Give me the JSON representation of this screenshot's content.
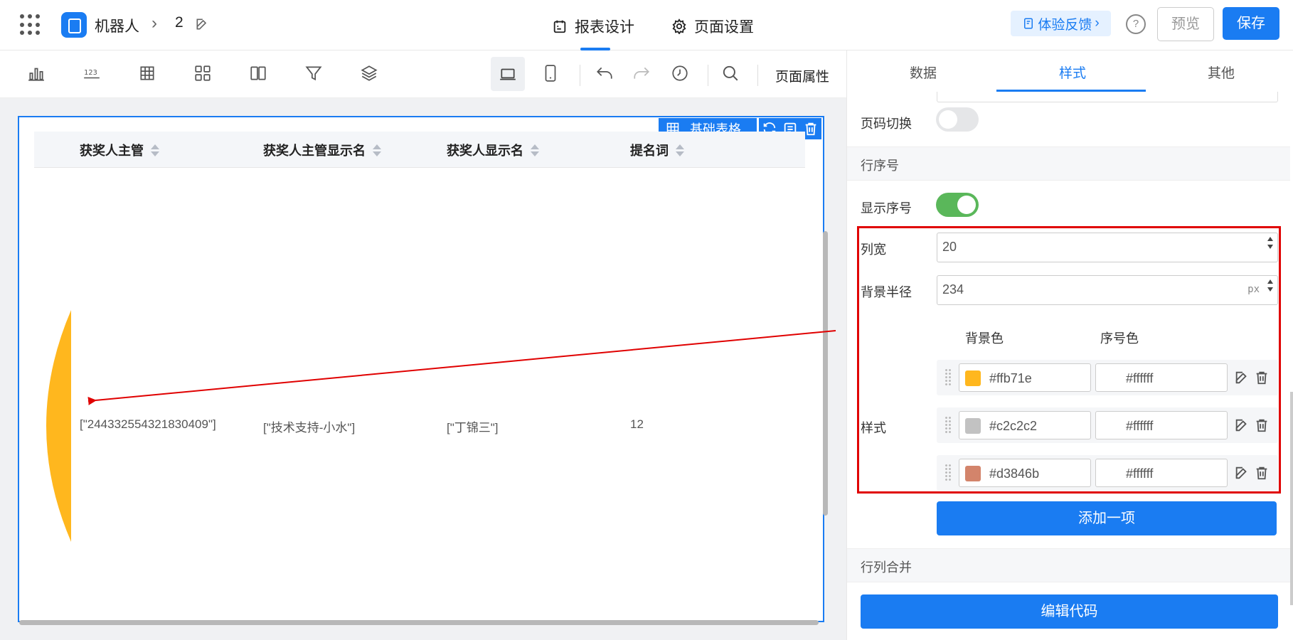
{
  "header": {
    "app_name": "机器人",
    "page_number": "2",
    "tabs": [
      {
        "label": "报表设计",
        "active": true
      },
      {
        "label": "页面设置",
        "active": false
      }
    ],
    "feedback_label": "体验反馈",
    "help_label": "?",
    "preview_label": "预览",
    "save_label": "保存"
  },
  "toolbar": {
    "icons": [
      "chart-icon",
      "number-icon",
      "table-icon",
      "layout-icon",
      "columns-icon",
      "filter-icon",
      "layers-icon",
      "desktop-icon",
      "mobile-icon",
      "undo-icon",
      "redo-icon",
      "history-icon",
      "search-icon"
    ],
    "page_props_label": "页面属性"
  },
  "canvas": {
    "component_label": "基础表格",
    "table": {
      "columns": [
        "获奖人主管",
        "获奖人主管显示名",
        "获奖人显示名",
        "提名词"
      ],
      "rows": [
        [
          "[\"244332554321830409\"]",
          "[\"技术支持-小水\"]",
          "[\"丁锦三\"]",
          "12"
        ]
      ]
    },
    "row_index_bg": "#ffb71e"
  },
  "panel": {
    "tabs": [
      {
        "label": "数据",
        "active": false
      },
      {
        "label": "样式",
        "active": true
      },
      {
        "label": "其他",
        "active": false
      }
    ],
    "page_switch_label": "页码切换",
    "page_switch_on": false,
    "row_index_section": "行序号",
    "show_index_label": "显示序号",
    "show_index_on": true,
    "col_width_label": "列宽",
    "col_width_value": "20",
    "bg_radius_label": "背景半径",
    "bg_radius_value": "234",
    "bg_radius_unit": "px",
    "style_label": "样式",
    "bg_color_header": "背景色",
    "index_color_header": "序号色",
    "styles": [
      {
        "bg": "#ffb71e",
        "fg": "#ffffff"
      },
      {
        "bg": "#c2c2c2",
        "fg": "#ffffff"
      },
      {
        "bg": "#d3846b",
        "fg": "#ffffff"
      }
    ],
    "add_item_label": "添加一项",
    "merge_section": "行列合并",
    "edit_code_label": "编辑代码"
  }
}
